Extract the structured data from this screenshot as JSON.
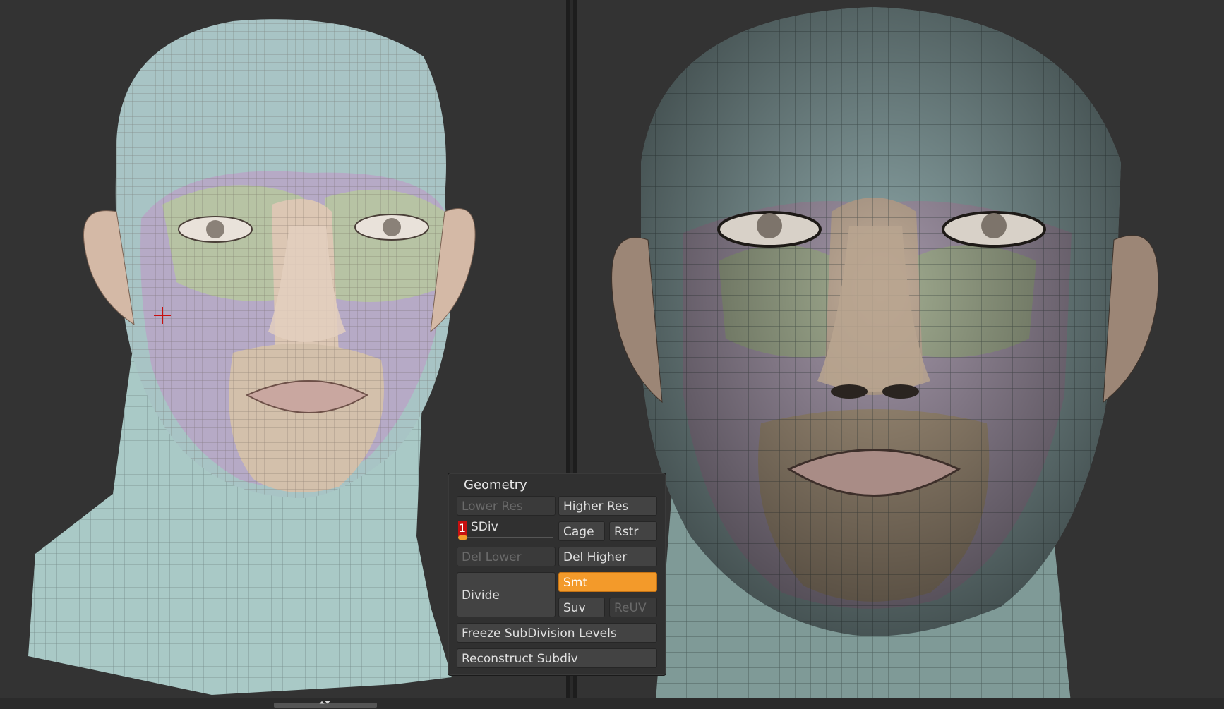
{
  "panel": {
    "title": "Geometry",
    "lower_res": "Lower Res",
    "higher_res": "Higher Res",
    "sdiv_value": "1",
    "sdiv_label": "SDiv",
    "sdiv_level_fraction": 0.1,
    "cage": "Cage",
    "rstr": "Rstr",
    "del_lower": "Del Lower",
    "del_higher": "Del Higher",
    "divide": "Divide",
    "smt": "Smt",
    "suv": "Suv",
    "reuv": "ReUV",
    "freeze": "Freeze SubDivision Levels",
    "reconstruct": "Reconstruct Subdiv"
  },
  "icons": {
    "cursor": "crosshair-cursor-icon",
    "handle": "updown-arrows-icon"
  },
  "colors": {
    "background": "#333333",
    "accent_orange": "#f39a2a",
    "sdiv_red": "#c81010",
    "mesh_teal": "#a9c5c4",
    "mesh_skin": "#d8c3b0",
    "mesh_lilac": "#b5a9c4",
    "mesh_green": "#b7c3a4"
  },
  "handle_glyph": "⏶⏷"
}
